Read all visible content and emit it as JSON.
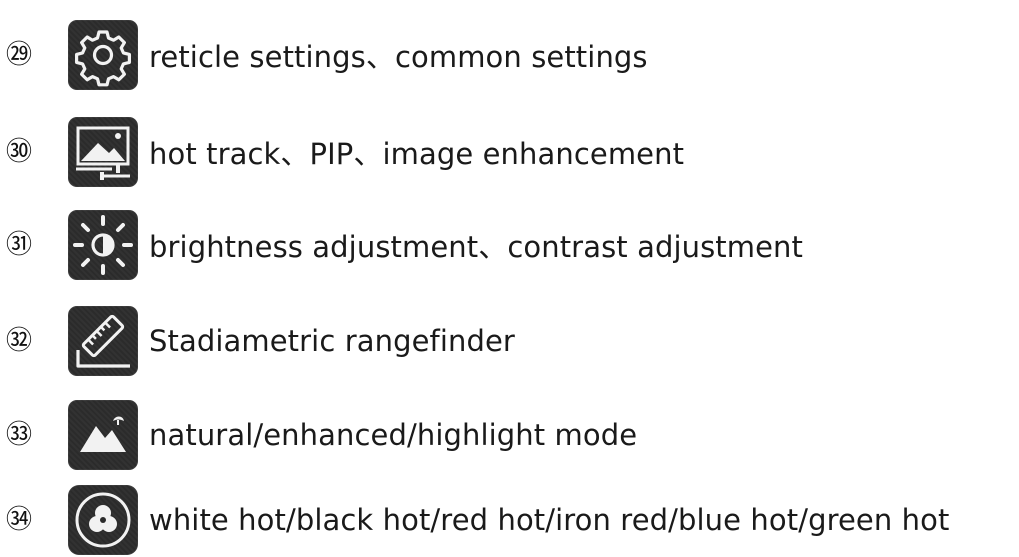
{
  "items": [
    {
      "number": "㉙",
      "icon": "gear-icon",
      "label": "reticle settings、common settings"
    },
    {
      "number": "㉚",
      "icon": "image-adjust-icon",
      "label": "hot track、PIP、image enhancement"
    },
    {
      "number": "㉛",
      "icon": "brightness-contrast-icon",
      "label": "brightness adjustment、contrast adjustment"
    },
    {
      "number": "㉜",
      "icon": "ruler-icon",
      "label": "Stadiametric rangefinder"
    },
    {
      "number": "㉝",
      "icon": "mountain-icon",
      "label": "natural/enhanced/highlight mode"
    },
    {
      "number": "㉞",
      "icon": "color-palette-icon",
      "label": "white hot/black hot/red hot/iron red/blue hot/green hot"
    }
  ]
}
